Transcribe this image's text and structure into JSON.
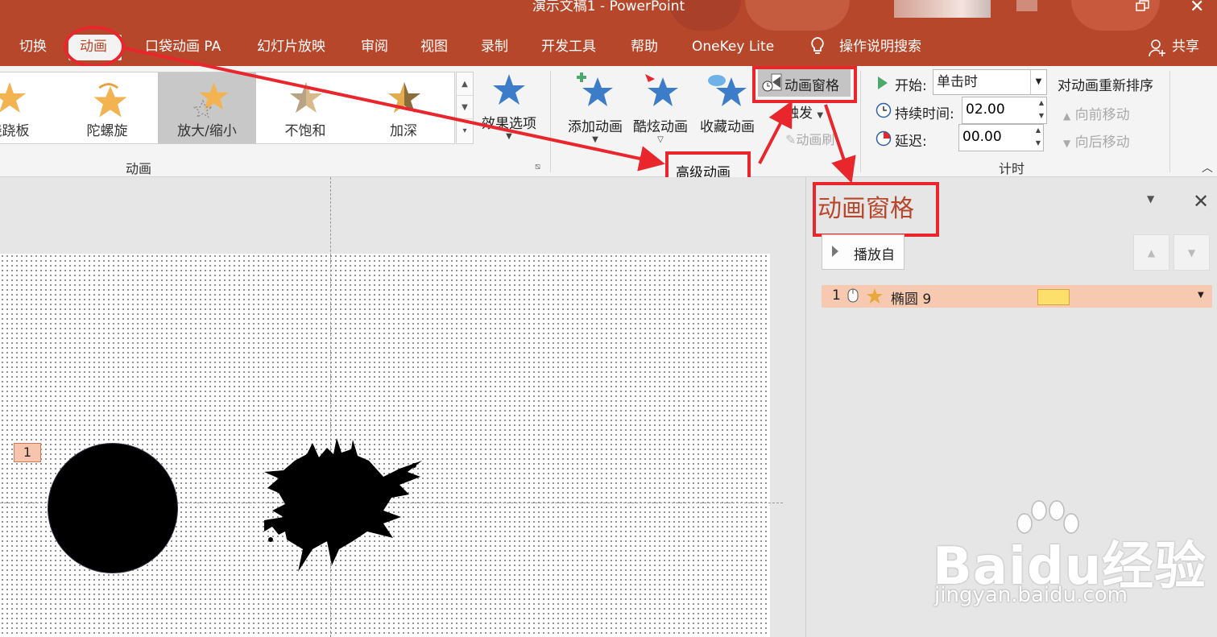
{
  "window": {
    "title": "演示文稿1  -  PowerPoint"
  },
  "tabs": [
    {
      "label": "切换"
    },
    {
      "label": "动画"
    },
    {
      "label": "口袋动画 PA"
    },
    {
      "label": "幻灯片放映"
    },
    {
      "label": "审阅"
    },
    {
      "label": "视图"
    },
    {
      "label": "录制"
    },
    {
      "label": "开发工具"
    },
    {
      "label": "帮助"
    },
    {
      "label": "OneKey Lite"
    },
    {
      "label": "操作说明搜索"
    }
  ],
  "share_label": "共享",
  "ribbon": {
    "gallery": [
      {
        "label": "跷跷板"
      },
      {
        "label": "陀螺旋"
      },
      {
        "label": "放大/缩小",
        "selected": true
      },
      {
        "label": "不饱和"
      },
      {
        "label": "加深"
      }
    ],
    "effect_options": "效果选项",
    "animation_group_label": "动画",
    "add_animation": "添加动画",
    "cool_animation": "酷炫动画",
    "collect_animation": "收藏动画",
    "animation_pane": "动画窗格",
    "trigger": "触发",
    "animation_brush": "动画刷",
    "advanced_group_label": "高级动画",
    "timing": {
      "start_label": "开始:",
      "start_value": "单击时",
      "duration_label": "持续时间:",
      "duration_value": "02.00",
      "delay_label": "延迟:",
      "delay_value": "00.00",
      "reorder_title": "对动画重新排序",
      "move_earlier": "向前移动",
      "move_later": "向后移动",
      "group_label": "计时"
    }
  },
  "slide": {
    "animation_tag": "1"
  },
  "pane": {
    "title": "动画窗格",
    "play_from": "播放自",
    "items": [
      {
        "number": "1",
        "name": "椭圆 9"
      }
    ]
  },
  "watermark": {
    "brand": "Baidu经验",
    "url": "jingyan.baidu.com"
  },
  "colors": {
    "accent": "#b7472a",
    "annotation_red": "#e8262c",
    "selected_row": "#f7c9b0",
    "timeline_bar": "#fde06b"
  }
}
